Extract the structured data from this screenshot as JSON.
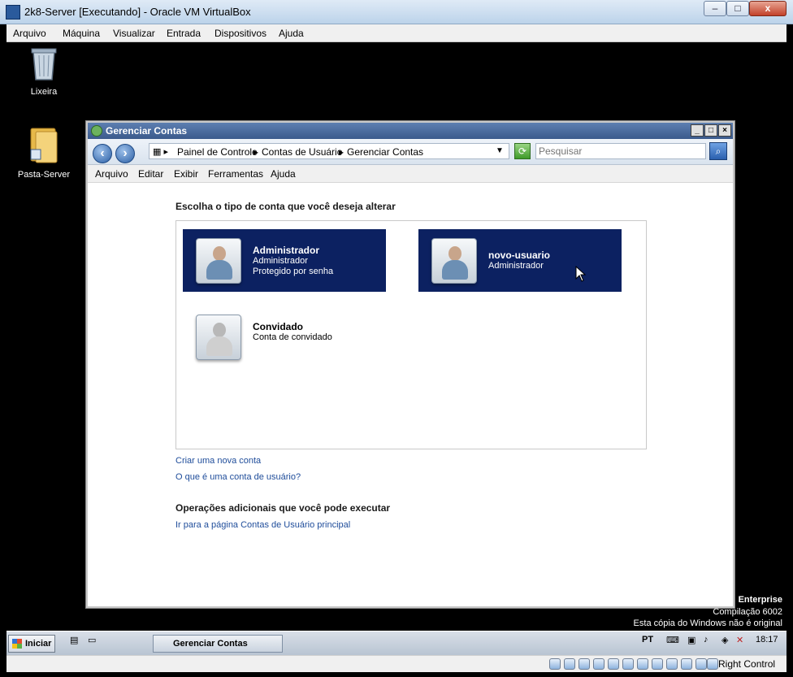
{
  "vbox": {
    "title": "2k8-Server [Executando] - Oracle VM VirtualBox",
    "controls": {
      "minimize": "–",
      "maximize": "□",
      "close": "x"
    },
    "menu": [
      "Arquivo",
      "Máquina",
      "Visualizar",
      "Entrada",
      "Dispositivos",
      "Ajuda"
    ],
    "status": {
      "hostkey": "Right Control"
    }
  },
  "desktop": {
    "icons": [
      {
        "label": "Lixeira",
        "icon": "recycle-bin-icon"
      },
      {
        "label": "Pasta-Server",
        "icon": "folder-icon"
      }
    ],
    "watermark": {
      "edition": "Enterprise",
      "build": "Compilação 6002",
      "notice": "Esta cópia do Windows não é original"
    }
  },
  "explorer": {
    "title": "Gerenciar Contas",
    "breadcrumb": [
      "Painel de Controle",
      "Contas de Usuário",
      "Gerenciar Contas"
    ],
    "search_placeholder": "Pesquisar",
    "menu": [
      "Arquivo",
      "Editar",
      "Exibir",
      "Ferramentas",
      "Ajuda"
    ],
    "heading": "Escolha o tipo de conta que você deseja alterar",
    "accounts": [
      {
        "name": "Administrador",
        "type": "Administrador",
        "extra": "Protegido por senha",
        "selected": true
      },
      {
        "name": "novo-usuario",
        "type": "Administrador",
        "extra": "",
        "selected": true
      },
      {
        "name": "Convidado",
        "type": "Conta de convidado",
        "extra": "",
        "selected": false
      }
    ],
    "links": [
      "Criar uma nova conta",
      "O que é uma conta de usuário?"
    ],
    "additional_heading": "Operações adicionais que você pode executar",
    "additional_link": "Ir para a página Contas de Usuário principal"
  },
  "taskbar": {
    "start_label": "Iniciar",
    "task_label": "Gerenciar Contas",
    "lang": "PT",
    "time": "18:17"
  },
  "colors": {
    "selected_account_bg": "#0c2161",
    "link": "#1e4c9a",
    "titlebar": "#3b5a8c"
  }
}
